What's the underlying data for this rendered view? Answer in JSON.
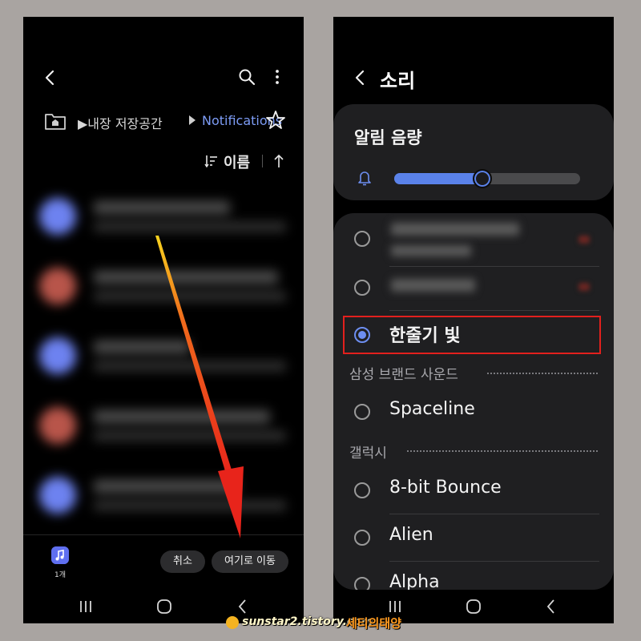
{
  "left_screen": {
    "breadcrumb": {
      "root": "▶내장 저장공간",
      "current": "Notifications"
    },
    "sort": {
      "label": "이름"
    },
    "bottom_bar": {
      "selected_count": "1개",
      "cancel_label": "취소",
      "move_label": "여기로 이동"
    }
  },
  "right_screen": {
    "title": "소리",
    "volume": {
      "title": "알림 음량",
      "level": 0.47
    },
    "ringtones": {
      "selected": "한줄기 빛",
      "section_samsung": "삼성 브랜드 사운드",
      "spaceline": "Spaceline",
      "section_galaxy": "갤럭시",
      "bounce": "8-bit Bounce",
      "alien": "Alien",
      "alpha": "Alpha"
    }
  },
  "watermark": {
    "url": "sunstar2.tistory.com",
    "name": "세티의태양"
  },
  "colors": {
    "accent_blue": "#5a82ea",
    "link_blue": "#7d9cf5",
    "highlight_red": "#e2201d",
    "arrow_red": "#e8241b",
    "arrow_yellow": "#f7d31f"
  }
}
